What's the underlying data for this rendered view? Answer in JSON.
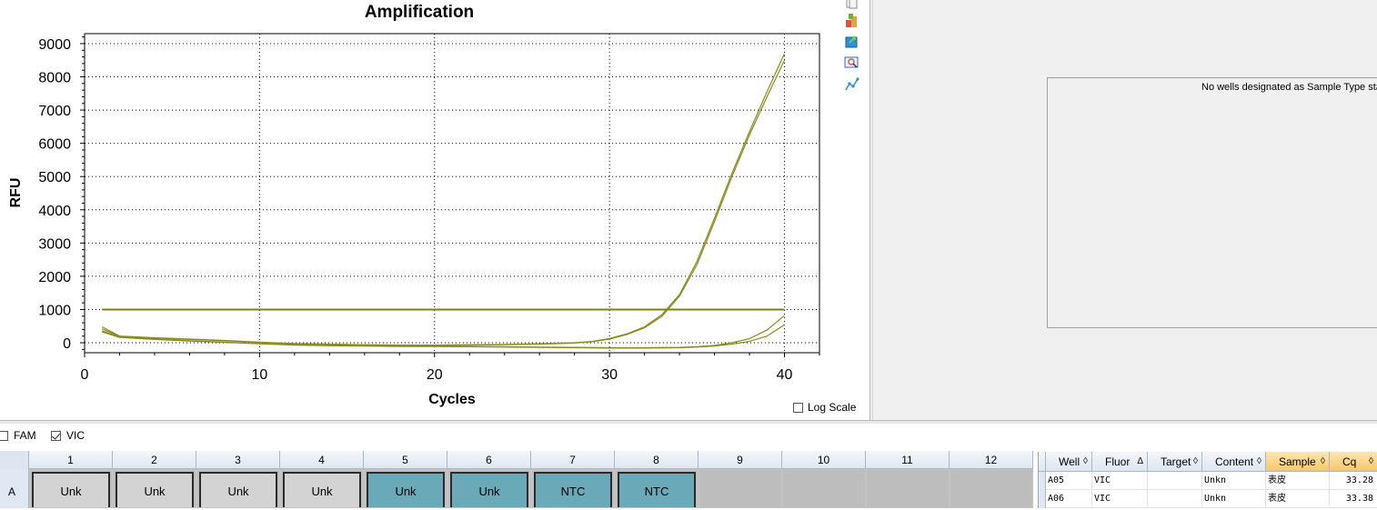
{
  "chart_data": {
    "type": "line",
    "title": "Amplification",
    "xlabel": "Cycles",
    "ylabel": "RFU",
    "xlim": [
      0,
      42
    ],
    "ylim": [
      -300,
      9300
    ],
    "xticks": [
      0,
      10,
      20,
      30,
      40
    ],
    "yticks": [
      0,
      1000,
      2000,
      3000,
      4000,
      5000,
      6000,
      7000,
      8000,
      9000
    ],
    "grid": true,
    "threshold": 1000,
    "line_color": "#8a8a1e",
    "series": [
      {
        "x": [
          1,
          2,
          4,
          6,
          8,
          10,
          12,
          14,
          16,
          18,
          20,
          22,
          24,
          26,
          28,
          29,
          30,
          31,
          32,
          33,
          34,
          35,
          36,
          37,
          38,
          39,
          40
        ],
        "values": [
          480,
          200,
          150,
          110,
          70,
          20,
          -20,
          -40,
          -60,
          -70,
          -80,
          -70,
          -60,
          -40,
          -10,
          30,
          110,
          250,
          450,
          800,
          1400,
          2350,
          3650,
          5000,
          6250,
          7400,
          8500
        ]
      },
      {
        "x": [
          1,
          2,
          4,
          6,
          8,
          10,
          12,
          14,
          16,
          18,
          20,
          22,
          24,
          26,
          28,
          29,
          30,
          31,
          32,
          33,
          34,
          35,
          36,
          37,
          38,
          39,
          40
        ],
        "values": [
          420,
          190,
          140,
          100,
          60,
          10,
          -30,
          -50,
          -60,
          -70,
          -70,
          -60,
          -50,
          -30,
          0,
          40,
          130,
          270,
          480,
          850,
          1450,
          2450,
          3750,
          5100,
          6350,
          7550,
          8700
        ]
      },
      {
        "x": [
          1,
          2,
          4,
          6,
          8,
          10,
          12,
          14,
          16,
          18,
          20,
          22,
          24,
          26,
          28,
          30,
          32,
          34,
          35,
          36,
          37,
          38,
          39,
          40
        ],
        "values": [
          360,
          170,
          110,
          60,
          20,
          -20,
          -60,
          -80,
          -90,
          -100,
          -100,
          -110,
          -120,
          -130,
          -140,
          -150,
          -150,
          -140,
          -120,
          -80,
          0,
          120,
          380,
          820
        ]
      },
      {
        "x": [
          1,
          2,
          4,
          6,
          8,
          10,
          12,
          14,
          16,
          18,
          20,
          22,
          24,
          26,
          28,
          30,
          32,
          34,
          35,
          36,
          37,
          38,
          39,
          40
        ],
        "values": [
          330,
          160,
          100,
          50,
          10,
          -30,
          -70,
          -90,
          -100,
          -110,
          -110,
          -120,
          -130,
          -140,
          -150,
          -160,
          -160,
          -150,
          -130,
          -100,
          -40,
          40,
          200,
          540
        ]
      }
    ]
  },
  "log_scale": {
    "label": "Log Scale",
    "checked": false
  },
  "toolbar_icons": [
    "copy-icon",
    "chart-color-icon",
    "export-icon",
    "zoom-icon",
    "graph-settings-icon"
  ],
  "standard_curve": {
    "message": "No wells designated as Sample Type standard."
  },
  "fluors": [
    {
      "label": "FAM",
      "checked": false
    },
    {
      "label": "VIC",
      "checked": true
    }
  ],
  "plate": {
    "columns": [
      "1",
      "2",
      "3",
      "4",
      "5",
      "6",
      "7",
      "8",
      "9",
      "10",
      "11",
      "12"
    ],
    "row_label": "A",
    "wells": [
      "Unk",
      "Unk",
      "Unk",
      "Unk",
      "Unk",
      "Unk",
      "NTC",
      "NTC",
      "",
      "",
      "",
      ""
    ]
  },
  "results_table": {
    "headers": [
      "Well",
      "Fluor",
      "Target",
      "Content",
      "Sample",
      "Cq"
    ],
    "rows": [
      [
        "A05",
        "VIC",
        "",
        "Unkn",
        "表皮",
        "33.28"
      ],
      [
        "A06",
        "VIC",
        "",
        "Unkn",
        "表皮",
        "33.38"
      ]
    ]
  }
}
